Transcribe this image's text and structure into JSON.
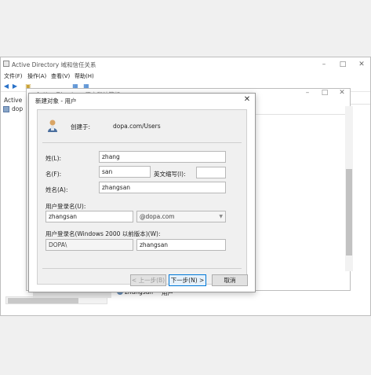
{
  "outer_window": {
    "title": "Active Directory 域和信任关系",
    "menu": [
      "文件(F)",
      "操作(A)",
      "查看(V)",
      "帮助(H)"
    ],
    "tree_items": [
      "Active",
      "dop"
    ]
  },
  "mid_window": {
    "title": "Active Directory 用户和计算机"
  },
  "dialog": {
    "title": "新建对象 - 用户",
    "created_in_label": "创建于:",
    "created_in_value": "dopa.com/Users",
    "last_name_label": "姓(L):",
    "last_name_value": "zhang",
    "first_name_label": "名(F):",
    "first_name_value": "san",
    "initials_label": "英文缩写(I):",
    "initials_value": "",
    "full_name_label": "姓名(A):",
    "full_name_value": "zhangsan",
    "logon_name_label": "用户登录名(U):",
    "logon_name_value": "zhangsan",
    "domain_value": "@dopa.com",
    "pre2000_label": "用户登录名(Windows 2000 以前版本)(W):",
    "pre2000_domain": "DOPA\\",
    "pre2000_name": "zhangsan",
    "back_button": "< 上一步(B)",
    "next_button": "下一步(N) >",
    "cancel_button": "取消"
  },
  "list_behind": {
    "user_name": "zhangsan",
    "user_type": "用户"
  }
}
